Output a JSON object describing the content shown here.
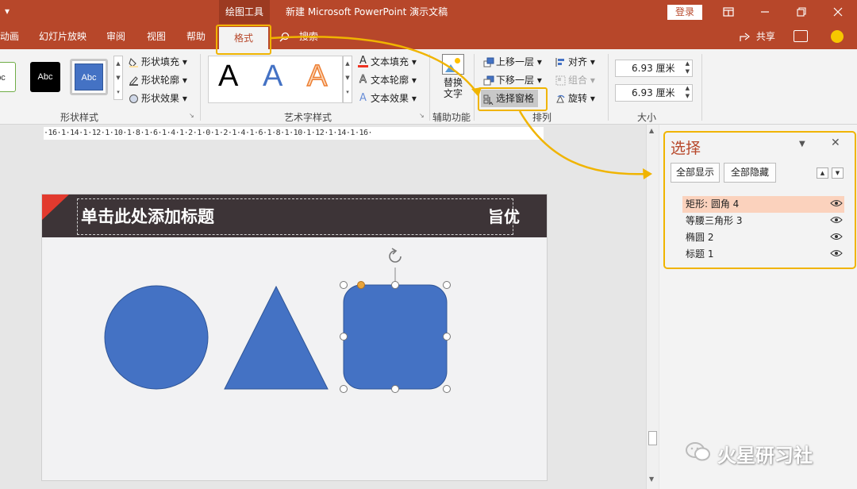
{
  "titlebar": {
    "quick_access": "▾",
    "context_tools": "绘图工具",
    "document_title": "新建 Microsoft PowerPoint 演示文稿",
    "login": "登录"
  },
  "tabs": [
    {
      "label": "动画"
    },
    {
      "label": "幻灯片放映"
    },
    {
      "label": "审阅"
    },
    {
      "label": "视图"
    },
    {
      "label": "帮助"
    },
    {
      "label": "格式",
      "active": true
    }
  ],
  "search": "搜索",
  "share": "共享",
  "ribbon": {
    "shape_styles": {
      "label": "形状样式",
      "swatches": [
        "bc",
        "Abc",
        "Abc"
      ],
      "fill": "形状填充",
      "outline": "形状轮廓",
      "effect": "形状效果"
    },
    "wordart": {
      "label": "艺术字样式",
      "letters": [
        "A",
        "A",
        "A"
      ],
      "text_fill": "文本填充",
      "text_outline": "文本轮廓",
      "text_effect": "文本效果"
    },
    "accessibility": {
      "label": "辅助功能",
      "alt_text_line1": "替换",
      "alt_text_line2": "文字"
    },
    "arrange": {
      "label": "排列",
      "bring_forward": "上移一层",
      "send_backward": "下移一层",
      "selection_pane": "选择窗格",
      "align": "对齐",
      "group": "组合",
      "rotate": "旋转"
    },
    "size": {
      "label": "大小",
      "height": "6.93 厘米",
      "width": "6.93 厘米"
    }
  },
  "ruler_text": "·16·1·14·1·12·1·10·1·8·1·6·1·4·1·2·1·0·1·2·1·4·1·6·1·8·1·10·1·12·1·14·1·16·",
  "slide": {
    "title": "单击此处添加标题",
    "logo": "旨优"
  },
  "selection_pane": {
    "title": "选择",
    "show_all": "全部显示",
    "hide_all": "全部隐藏",
    "items": [
      {
        "label": "矩形: 圆角 4",
        "selected": true
      },
      {
        "label": "等腰三角形 3"
      },
      {
        "label": "椭圆 2"
      },
      {
        "label": "标题 1"
      }
    ]
  },
  "watermark": "火星研习社",
  "colors": {
    "accent": "#b7472a",
    "shape_fill": "#4472c4",
    "highlight": "#f0b400",
    "selected_item": "#fbd2bd"
  }
}
